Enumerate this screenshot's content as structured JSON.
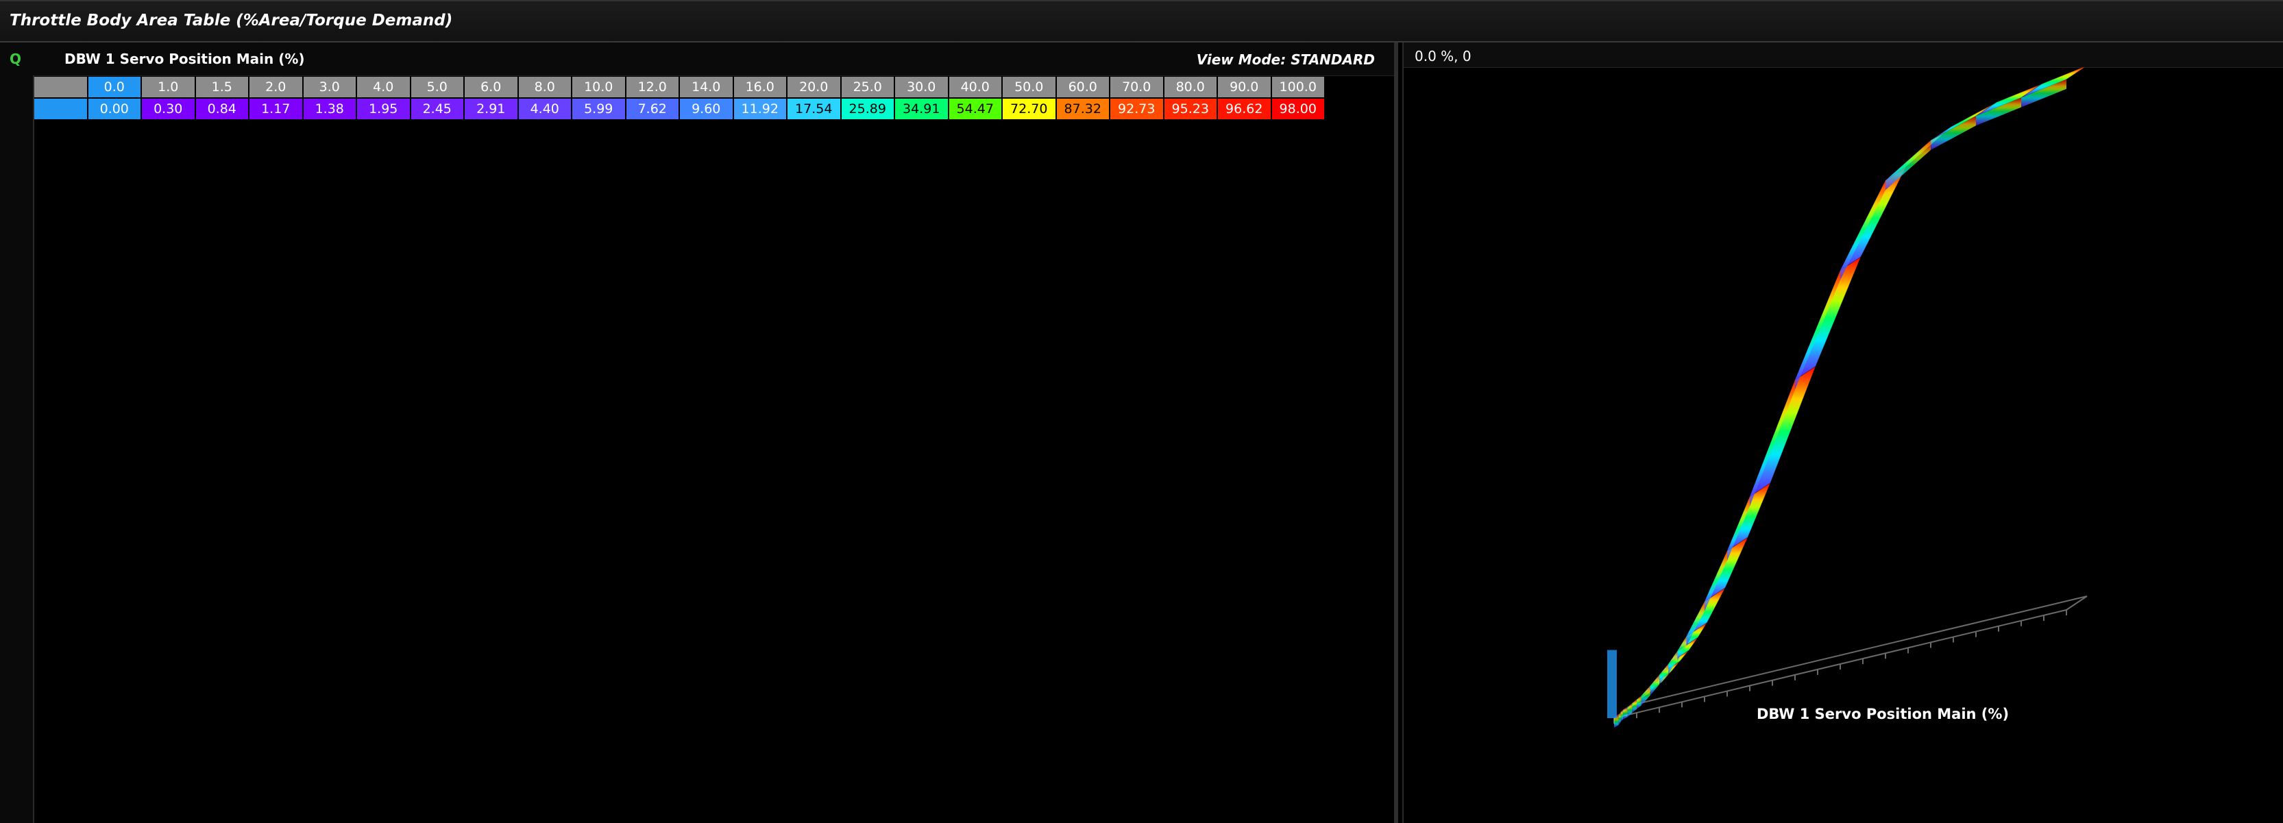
{
  "window": {
    "title": "Throttle Body Area Table (%Area/Torque Demand)"
  },
  "table_panel": {
    "q_badge": "Q",
    "title": "DBW 1 Servo Position Main (%)",
    "view_mode": "View Mode: STANDARD",
    "selected_column": 0,
    "x_axis": [
      "0.0",
      "1.0",
      "1.5",
      "2.0",
      "3.0",
      "4.0",
      "5.0",
      "6.0",
      "8.0",
      "10.0",
      "12.0",
      "14.0",
      "16.0",
      "20.0",
      "25.0",
      "30.0",
      "40.0",
      "50.0",
      "60.0",
      "70.0",
      "80.0",
      "90.0",
      "100.0"
    ],
    "values": [
      "0.00",
      "0.30",
      "0.84",
      "1.17",
      "1.38",
      "1.95",
      "2.45",
      "2.91",
      "4.40",
      "5.99",
      "7.62",
      "9.60",
      "11.92",
      "17.54",
      "25.89",
      "34.91",
      "54.47",
      "72.70",
      "87.32",
      "92.73",
      "95.23",
      "96.62",
      "98.00"
    ],
    "cell_colors": [
      "#2196f3",
      "#7b00ff",
      "#7d00ff",
      "#7f00ff",
      "#7e06ff",
      "#7a14ff",
      "#7620ff",
      "#7228ff",
      "#6840ff",
      "#5a58ff",
      "#4d6cff",
      "#3f85ff",
      "#3da0ff",
      "#2bd4ff",
      "#00ffd0",
      "#00ff70",
      "#50ff00",
      "#ffff00",
      "#ff7a00",
      "#ff4a00",
      "#ff2800",
      "#ff1400",
      "#ff0000"
    ],
    "cell_text_colors": [
      "#ffffff",
      "#ffffff",
      "#ffffff",
      "#ffffff",
      "#ffffff",
      "#ffffff",
      "#ffffff",
      "#ffffff",
      "#ffffff",
      "#ffffff",
      "#ffffff",
      "#ffffff",
      "#ffffff",
      "#000000",
      "#000000",
      "#000000",
      "#000000",
      "#000000",
      "#000000",
      "#ffffff",
      "#ffffff",
      "#ffffff",
      "#ffffff"
    ]
  },
  "graph_panel": {
    "cursor_readout": "0.0 %, 0",
    "axis_label": "DBW 1 Servo Position Main (%)"
  },
  "colors": {
    "selection": "#2196f3",
    "header_cell": "#8c8c8c",
    "q_badge": "#3ec93e"
  }
}
